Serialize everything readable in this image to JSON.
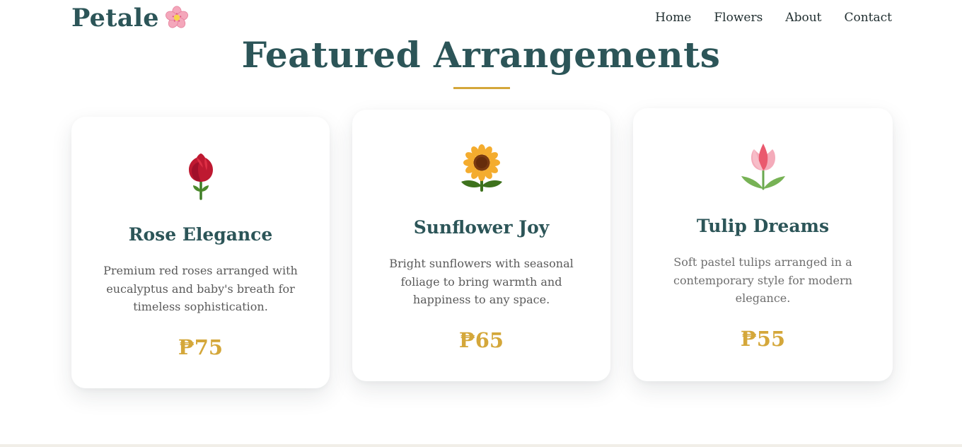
{
  "header": {
    "brand": "Petale",
    "brand_icon": "cherry-blossom-icon",
    "nav": [
      "Home",
      "Flowers",
      "About",
      "Contact"
    ]
  },
  "section": {
    "title": "Featured Arrangements",
    "accent_color": "#d4a73a",
    "title_color": "#2c5558"
  },
  "products": [
    {
      "icon": "rose-icon",
      "name": "Rose Elegance",
      "description": "Premium red roses arranged with eucalyptus and baby's breath for timeless sophistication.",
      "price": "₱75"
    },
    {
      "icon": "sunflower-icon",
      "name": "Sunflower Joy",
      "description": "Bright sunflowers with seasonal foliage to bring warmth and happiness to any space.",
      "price": "₱65"
    },
    {
      "icon": "tulip-icon",
      "name": "Tulip Dreams",
      "description": "Soft pastel tulips arranged in a contemporary style for modern elegance.",
      "price": "₱55"
    }
  ]
}
